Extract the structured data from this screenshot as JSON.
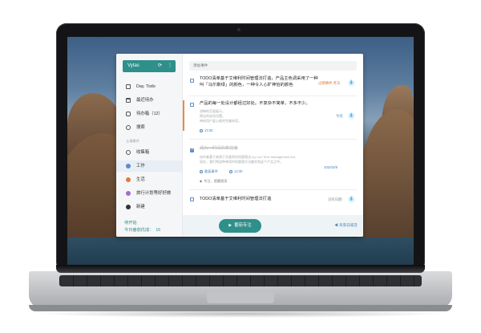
{
  "user": {
    "name": "Vytas"
  },
  "sidebar": {
    "items": [
      {
        "label": "Day. Todo",
        "icon": "today-square-icon"
      },
      {
        "label": "最近待办",
        "icon": "calendar-icon"
      },
      {
        "label": "待办箱（12）",
        "icon": "inbox-icon"
      },
      {
        "label": "搜索",
        "icon": "search-icon"
      }
    ],
    "section_title": "土壤最终",
    "lists": [
      {
        "label": "收集箱",
        "color": "#555555"
      },
      {
        "label": "工作",
        "color": "#5b8bc8"
      },
      {
        "label": "生活",
        "color": "#e07b39"
      },
      {
        "label": "旅行计划等好好做",
        "color": "#a070c8"
      },
      {
        "label": "新建",
        "color": "#333333"
      }
    ]
  },
  "search": {
    "placeholder": "添加事件"
  },
  "tasks": [
    {
      "title": "TODO清单基于艾维利时间管理法打造，产品主色调采用了一种叫「马尔斯绿」的颜色，一种令人心旷神怡的颜色",
      "meta": "过期事件 昨天",
      "checked": false
    },
    {
      "title": "产品的每一处设计都经过好处。不复杂不简单，不多不少。",
      "subs": [
        "流畅的页面展示。",
        "简洁的选项设置。",
        "带给用户爱心般的完美体验。"
      ],
      "meta": "今天",
      "time": "13:30",
      "checked": false
    },
    {
      "title": "成为一时间的掌控者",
      "subs": [
        "由作者基于来源于艾维利时间管理法 Ivy Lee Time Management Act,",
        "现在，我们将这种神奇时间管理方法融合到这个产品之中。"
      ],
      "meta": "2020/3/9",
      "repeat": "重复事件",
      "time": "13:30",
      "tag": "专注、提醒我家",
      "checked": true
    },
    {
      "title": "TODO清单基于艾维利时间管理法打造",
      "meta": "没有日期",
      "checked": false
    }
  ],
  "footer": {
    "line1": "待开始",
    "line2_label": "今日番茄优成：",
    "line2_value": "16",
    "focus_label": "番茄专注",
    "sound_label": "背景白噪音"
  },
  "colors": {
    "accent": "#2f8f8a",
    "blue": "#5b8bc8",
    "orange": "#e07b39"
  }
}
